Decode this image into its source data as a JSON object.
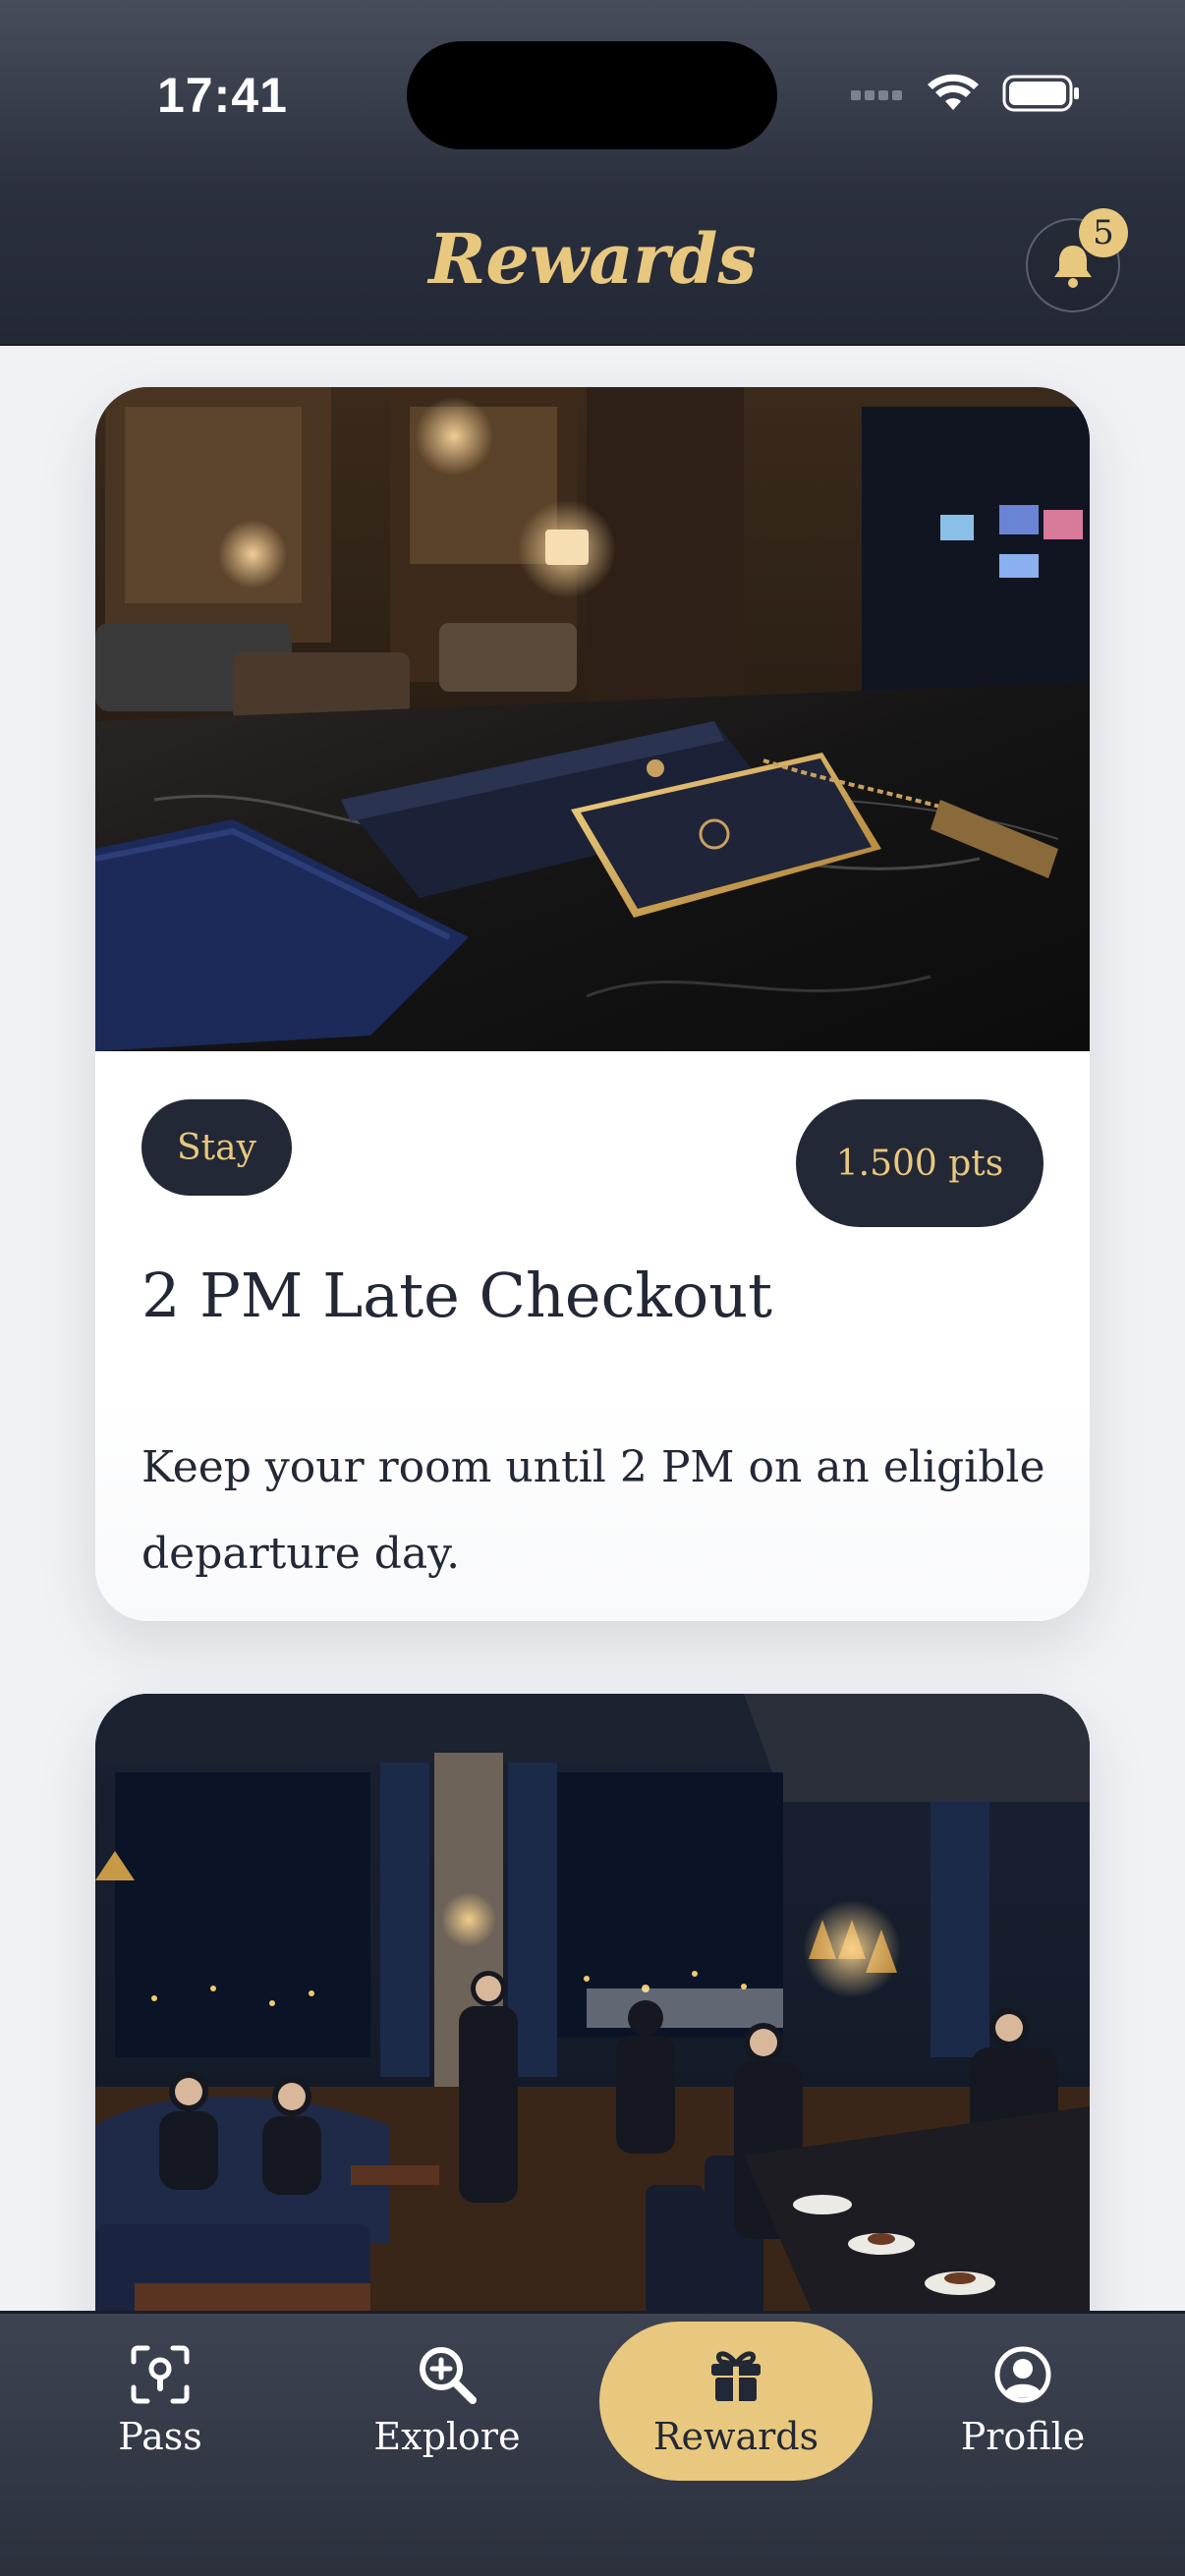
{
  "status_bar": {
    "time": "17:41"
  },
  "header": {
    "title": "Rewards",
    "notification_count": "5"
  },
  "rewards": [
    {
      "tag": "Stay",
      "points": "1.500 pts",
      "title": "2 PM Late Checkout",
      "description": "Keep your room until 2 PM on an eligible departure day."
    },
    {
      "tag": "",
      "points": "",
      "title": "",
      "description": ""
    }
  ],
  "tabbar": {
    "items": [
      {
        "label": "Pass",
        "icon": "pass-icon"
      },
      {
        "label": "Explore",
        "icon": "explore-icon"
      },
      {
        "label": "Rewards",
        "icon": "gift-icon",
        "active": true
      },
      {
        "label": "Profile",
        "icon": "profile-icon"
      }
    ]
  },
  "colors": {
    "accent_gold": "#e8c87e",
    "navy": "#232836",
    "background": "#f1f2f6"
  }
}
